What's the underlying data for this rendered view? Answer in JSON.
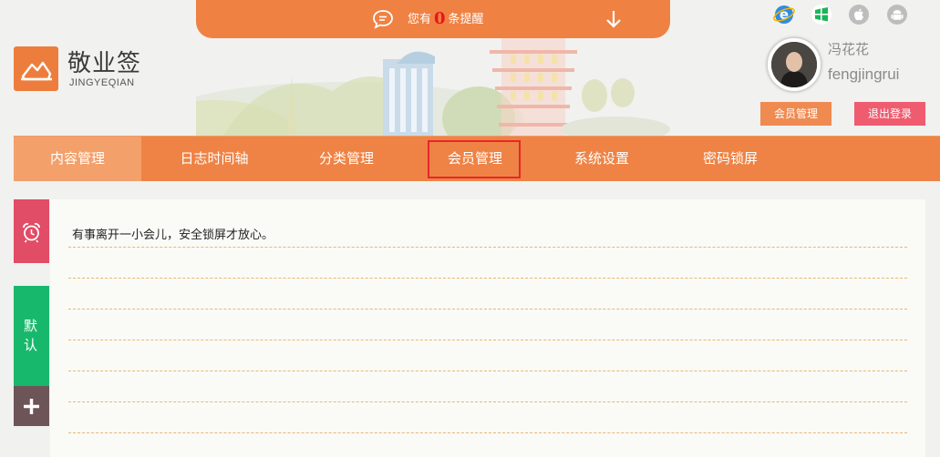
{
  "notification": {
    "prefix": "您有",
    "count": "0",
    "suffix": "条提醒"
  },
  "brand": {
    "name": "敬业签",
    "subtitle": "JINGYEQIAN"
  },
  "platforms": [
    {
      "name": "ie-icon",
      "color": "#2f8de0"
    },
    {
      "name": "windows-icon",
      "color": "#1cb55a"
    },
    {
      "name": "apple-icon",
      "color": "#bdbdbd"
    },
    {
      "name": "android-icon",
      "color": "#bdbdbd"
    }
  ],
  "user": {
    "nickname": "冯花花",
    "username": "fengjingrui",
    "member_button": "会员管理",
    "logout_button": "退出登录"
  },
  "nav": {
    "items": [
      {
        "label": "内容管理",
        "active": true
      },
      {
        "label": "日志时间轴",
        "active": false
      },
      {
        "label": "分类管理",
        "active": false
      },
      {
        "label": "会员管理",
        "active": false
      },
      {
        "label": "系统设置",
        "active": false
      },
      {
        "label": "密码锁屏",
        "active": false
      }
    ],
    "highlighted": "会员管理"
  },
  "sidebar": {
    "lock_icon": "alarm-clock-icon",
    "default_label": "默认",
    "add_icon": "plus-icon"
  },
  "note": {
    "text": "有事离开一小会儿，安全锁屏才放心。"
  },
  "colors": {
    "accent": "#ee8345",
    "notify_count": "#e8151b",
    "logout": "#ef5b6f",
    "lock_tab": "#e14c66",
    "default_tab": "#18b86c",
    "add_tab": "#6c5457"
  }
}
